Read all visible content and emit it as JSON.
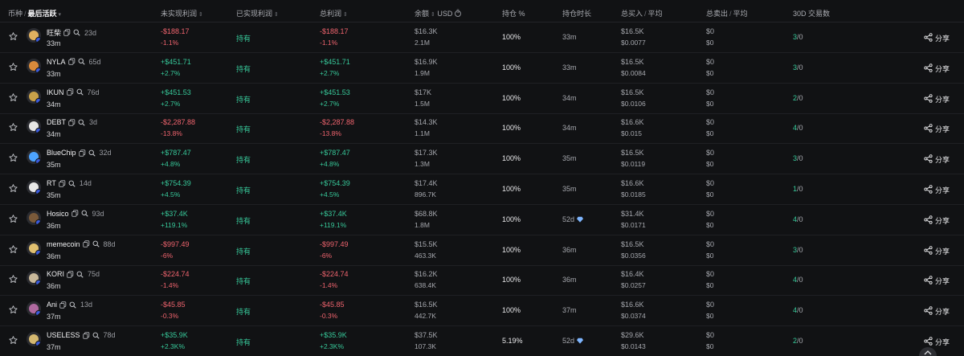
{
  "headers": {
    "token": "币种",
    "last_active": "最后活跃",
    "unrealized": "未实现利润",
    "realized": "已实现利润",
    "total_profit": "总利润",
    "balance": "余额",
    "balance_unit": "USD",
    "holding_pct": "持仓 %",
    "holding_duration": "持仓时长",
    "total_buy": "总买入",
    "total_buy_avg": "平均",
    "total_sell": "总卖出",
    "total_sell_avg": "平均",
    "trades_30d": "30D 交易数"
  },
  "share_label": "分享",
  "colors": {
    "background": "#111214",
    "negative": "#f0646e",
    "positive": "#37c99a"
  },
  "rows": [
    {
      "name": "旺柴",
      "age": "23d",
      "last_active": "33m",
      "unrealized": "-$188.17",
      "unrealized_pct": "-1.1%",
      "realized": "持有",
      "total": "-$188.17",
      "total_pct": "-1.1%",
      "balance": "$16.3K",
      "balance_qty": "2.1M",
      "hold_pct": "100%",
      "duration": "33m",
      "buy": "$16.5K",
      "buy_avg": "$0.0077",
      "sell": "$0",
      "sell_avg": "$0",
      "buys": "3",
      "sells": "0",
      "trend": "neg",
      "diamond": false
    },
    {
      "name": "NYLA",
      "age": "65d",
      "last_active": "33m",
      "unrealized": "+$451.71",
      "unrealized_pct": "+2.7%",
      "realized": "持有",
      "total": "+$451.71",
      "total_pct": "+2.7%",
      "balance": "$16.9K",
      "balance_qty": "1.9M",
      "hold_pct": "100%",
      "duration": "33m",
      "buy": "$16.5K",
      "buy_avg": "$0.0084",
      "sell": "$0",
      "sell_avg": "$0",
      "buys": "3",
      "sells": "0",
      "trend": "pos",
      "diamond": false
    },
    {
      "name": "IKUN",
      "age": "76d",
      "last_active": "34m",
      "unrealized": "+$451.53",
      "unrealized_pct": "+2.7%",
      "realized": "持有",
      "total": "+$451.53",
      "total_pct": "+2.7%",
      "balance": "$17K",
      "balance_qty": "1.5M",
      "hold_pct": "100%",
      "duration": "34m",
      "buy": "$16.5K",
      "buy_avg": "$0.0106",
      "sell": "$0",
      "sell_avg": "$0",
      "buys": "2",
      "sells": "0",
      "trend": "pos",
      "diamond": false
    },
    {
      "name": "DEBT",
      "age": "3d",
      "last_active": "34m",
      "unrealized": "-$2,287.88",
      "unrealized_pct": "-13.8%",
      "realized": "持有",
      "total": "-$2,287.88",
      "total_pct": "-13.8%",
      "balance": "$14.3K",
      "balance_qty": "1.1M",
      "hold_pct": "100%",
      "duration": "34m",
      "buy": "$16.6K",
      "buy_avg": "$0.015",
      "sell": "$0",
      "sell_avg": "$0",
      "buys": "4",
      "sells": "0",
      "trend": "neg",
      "diamond": false
    },
    {
      "name": "BlueChip",
      "age": "32d",
      "last_active": "35m",
      "unrealized": "+$787.47",
      "unrealized_pct": "+4.8%",
      "realized": "持有",
      "total": "+$787.47",
      "total_pct": "+4.8%",
      "balance": "$17.3K",
      "balance_qty": "1.3M",
      "hold_pct": "100%",
      "duration": "35m",
      "buy": "$16.5K",
      "buy_avg": "$0.0119",
      "sell": "$0",
      "sell_avg": "$0",
      "buys": "3",
      "sells": "0",
      "trend": "pos",
      "diamond": false
    },
    {
      "name": "RT",
      "age": "14d",
      "last_active": "35m",
      "unrealized": "+$754.39",
      "unrealized_pct": "+4.5%",
      "realized": "持有",
      "total": "+$754.39",
      "total_pct": "+4.5%",
      "balance": "$17.4K",
      "balance_qty": "896.7K",
      "hold_pct": "100%",
      "duration": "35m",
      "buy": "$16.6K",
      "buy_avg": "$0.0185",
      "sell": "$0",
      "sell_avg": "$0",
      "buys": "1",
      "sells": "0",
      "trend": "pos",
      "diamond": false
    },
    {
      "name": "Hosico",
      "age": "93d",
      "last_active": "36m",
      "unrealized": "+$37.4K",
      "unrealized_pct": "+119.1%",
      "realized": "持有",
      "total": "+$37.4K",
      "total_pct": "+119.1%",
      "balance": "$68.8K",
      "balance_qty": "1.8M",
      "hold_pct": "100%",
      "duration": "52d",
      "buy": "$31.4K",
      "buy_avg": "$0.0171",
      "sell": "$0",
      "sell_avg": "$0",
      "buys": "4",
      "sells": "0",
      "trend": "pos",
      "diamond": true
    },
    {
      "name": "memecoin",
      "age": "88d",
      "last_active": "36m",
      "unrealized": "-$997.49",
      "unrealized_pct": "-6%",
      "realized": "持有",
      "total": "-$997.49",
      "total_pct": "-6%",
      "balance": "$15.5K",
      "balance_qty": "463.3K",
      "hold_pct": "100%",
      "duration": "36m",
      "buy": "$16.5K",
      "buy_avg": "$0.0356",
      "sell": "$0",
      "sell_avg": "$0",
      "buys": "3",
      "sells": "0",
      "trend": "neg",
      "diamond": false
    },
    {
      "name": "KORI",
      "age": "75d",
      "last_active": "36m",
      "unrealized": "-$224.74",
      "unrealized_pct": "-1.4%",
      "realized": "持有",
      "total": "-$224.74",
      "total_pct": "-1.4%",
      "balance": "$16.2K",
      "balance_qty": "638.4K",
      "hold_pct": "100%",
      "duration": "36m",
      "buy": "$16.4K",
      "buy_avg": "$0.0257",
      "sell": "$0",
      "sell_avg": "$0",
      "buys": "4",
      "sells": "0",
      "trend": "neg",
      "diamond": false
    },
    {
      "name": "Ani",
      "age": "13d",
      "last_active": "37m",
      "unrealized": "-$45.85",
      "unrealized_pct": "-0.3%",
      "realized": "持有",
      "total": "-$45.85",
      "total_pct": "-0.3%",
      "balance": "$16.5K",
      "balance_qty": "442.7K",
      "hold_pct": "100%",
      "duration": "37m",
      "buy": "$16.6K",
      "buy_avg": "$0.0374",
      "sell": "$0",
      "sell_avg": "$0",
      "buys": "4",
      "sells": "0",
      "trend": "neg",
      "diamond": false
    },
    {
      "name": "USELESS",
      "age": "78d",
      "last_active": "37m",
      "unrealized": "+$35.9K",
      "unrealized_pct": "+2.3K%",
      "realized": "持有",
      "total": "+$35.9K",
      "total_pct": "+2.3K%",
      "balance": "$37.5K",
      "balance_qty": "107.3K",
      "hold_pct": "5.19%",
      "duration": "52d",
      "buy": "$29.6K",
      "buy_avg": "$0.0143",
      "sell": "$0",
      "sell_avg": "$0",
      "buys": "2",
      "sells": "0",
      "trend": "pos",
      "diamond": true
    }
  ]
}
